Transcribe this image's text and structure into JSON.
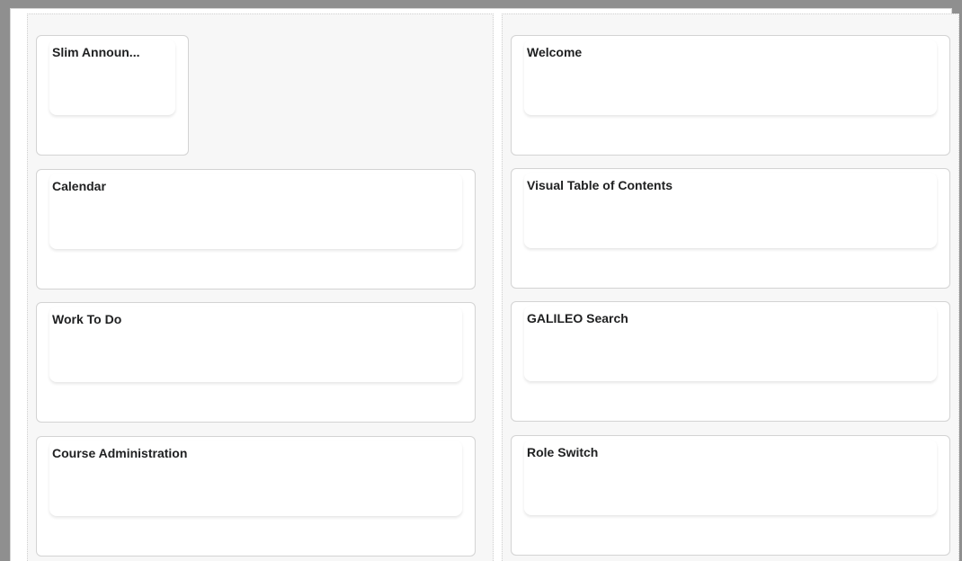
{
  "layout": {
    "left_column": {
      "widgets": [
        {
          "title": "Slim Announ..."
        },
        {
          "title": "Calendar"
        },
        {
          "title": "Work To Do"
        },
        {
          "title": "Course Administration"
        }
      ]
    },
    "right_column": {
      "widgets": [
        {
          "title": "Welcome"
        },
        {
          "title": "Visual Table of Contents"
        },
        {
          "title": "GALILEO Search"
        },
        {
          "title": "Role Switch"
        }
      ]
    }
  }
}
